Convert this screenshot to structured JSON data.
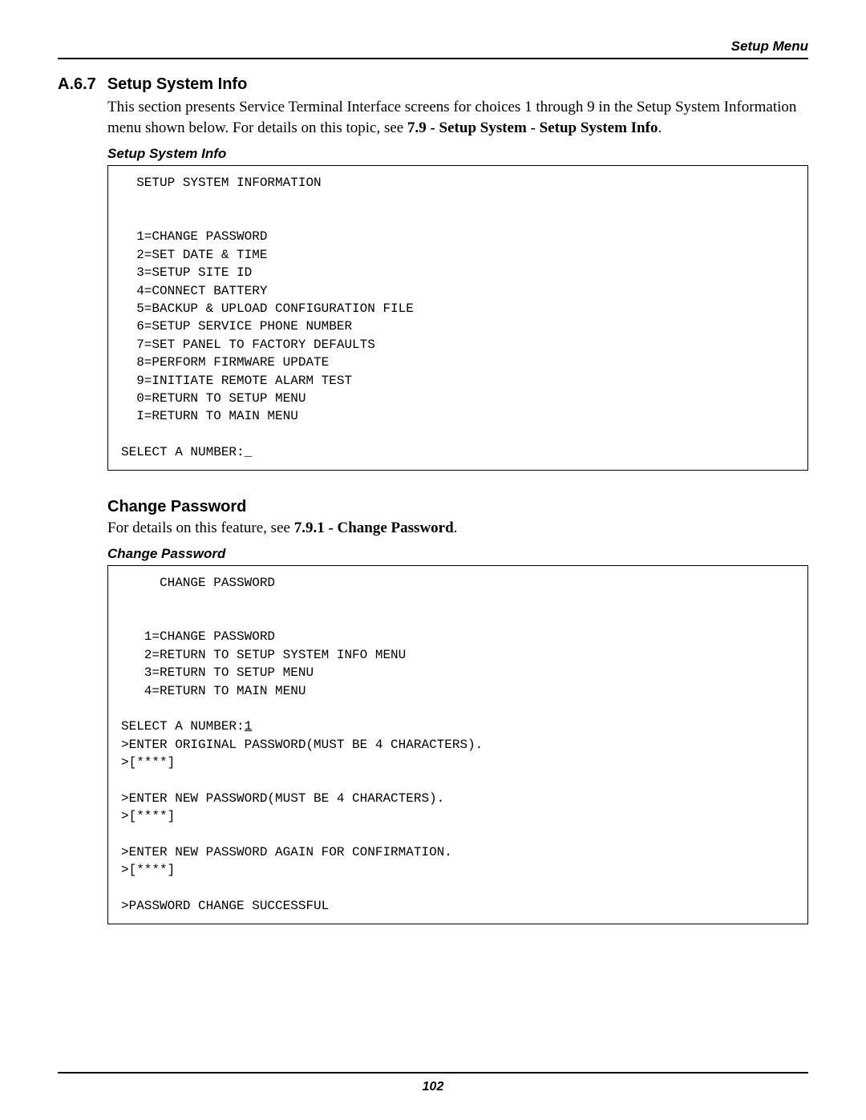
{
  "header": {
    "right": "Setup Menu"
  },
  "section": {
    "number": "A.6.7",
    "title": "Setup System Info",
    "intro_pre": "This section presents Service Terminal Interface screens for choices 1 through 9 in the Setup System Information menu shown below. For details on this topic, see ",
    "intro_bold": "7.9 - Setup System - Setup System Info",
    "intro_post": "."
  },
  "caption1": "Setup System Info",
  "terminal1": {
    "title": "  SETUP SYSTEM INFORMATION",
    "items": [
      "  1=CHANGE PASSWORD",
      "  2=SET DATE & TIME",
      "  3=SETUP SITE ID",
      "  4=CONNECT BATTERY",
      "  5=BACKUP & UPLOAD CONFIGURATION FILE",
      "  6=SETUP SERVICE PHONE NUMBER",
      "  7=SET PANEL TO FACTORY DEFAULTS",
      "  8=PERFORM FIRMWARE UPDATE",
      "  9=INITIATE REMOTE ALARM TEST",
      "  0=RETURN TO SETUP MENU",
      "  I=RETURN TO MAIN MENU"
    ],
    "prompt": "SELECT A NUMBER:_"
  },
  "sub": {
    "title": "Change Password",
    "para_pre": "For details on this feature, see ",
    "para_bold": "7.9.1 - Change Password",
    "para_post": "."
  },
  "caption2": "Change Password",
  "terminal2": {
    "title": "     CHANGE PASSWORD",
    "items": [
      "   1=CHANGE PASSWORD",
      "   2=RETURN TO SETUP SYSTEM INFO MENU",
      "   3=RETURN TO SETUP MENU",
      "   4=RETURN TO MAIN MENU"
    ],
    "prompt_label": "SELECT A NUMBER:",
    "prompt_value": "1",
    "lines": [
      "",
      ">ENTER ORIGINAL PASSWORD(MUST BE 4 CHARACTERS).",
      ">[****]",
      "",
      ">ENTER NEW PASSWORD(MUST BE 4 CHARACTERS).",
      ">[****]",
      "",
      ">ENTER NEW PASSWORD AGAIN FOR CONFIRMATION.",
      ">[****]",
      "",
      ">PASSWORD CHANGE SUCCESSFUL"
    ]
  },
  "page_number": "102"
}
